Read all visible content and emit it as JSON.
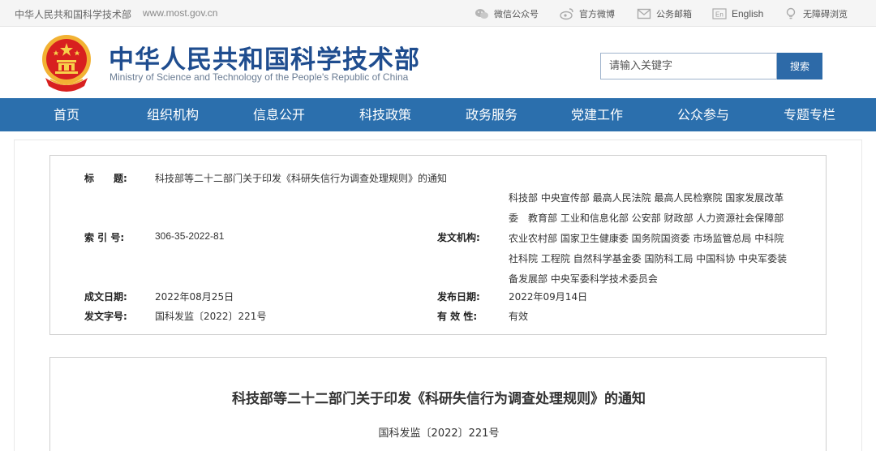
{
  "topbar": {
    "site_name": "中华人民共和国科学技术部",
    "site_url": "www.most.gov.cn",
    "links": [
      {
        "label": "微信公众号",
        "icon": "wechat-icon"
      },
      {
        "label": "官方微博",
        "icon": "weibo-icon"
      },
      {
        "label": "公务邮箱",
        "icon": "mail-icon"
      },
      {
        "label": "English",
        "icon": "english-icon"
      },
      {
        "label": "无障碍浏览",
        "icon": "accessibility-icon"
      }
    ]
  },
  "header": {
    "title_cn": "中华人民共和国科学技术部",
    "title_en": "Ministry of Science and Technology of the People's Republic of China",
    "search_placeholder": "请输入关键字",
    "search_button": "搜索",
    "brand_color": "#1f4d8f"
  },
  "nav": {
    "color": "#2b6fad",
    "items": [
      "首页",
      "组织机构",
      "信息公开",
      "科技政策",
      "政务服务",
      "党建工作",
      "公众参与",
      "专题专栏"
    ]
  },
  "meta": {
    "title_label": "标　　题:",
    "title_value": "科技部等二十二部门关于印发《科研失信行为调查处理规则》的通知",
    "index_label": "索 引 号:",
    "index_value": "306-35-2022-81",
    "issuer_label": "发文机构:",
    "issuer_value": "科技部 中央宣传部 最高人民法院 最高人民检察院 国家发展改革委　教育部 工业和信息化部 公安部 财政部 人力资源社会保障部　农业农村部 国家卫生健康委 国务院国资委 市场监管总局 中科院 社科院 工程院 自然科学基金委 国防科工局 中国科协 中央军委装备发展部 中央军委科学技术委员会",
    "written_label": "成文日期:",
    "written_value": "2022年08月25日",
    "published_label": "发布日期:",
    "published_value": "2022年09月14日",
    "docno_label": "发文字号:",
    "docno_value": "国科发监〔2022〕221号",
    "validity_label": "有 效 性:",
    "validity_value": "有效"
  },
  "doc": {
    "title": "科技部等二十二部门关于印发《科研失信行为调查处理规则》的通知",
    "number": "国科发监〔2022〕221号"
  }
}
